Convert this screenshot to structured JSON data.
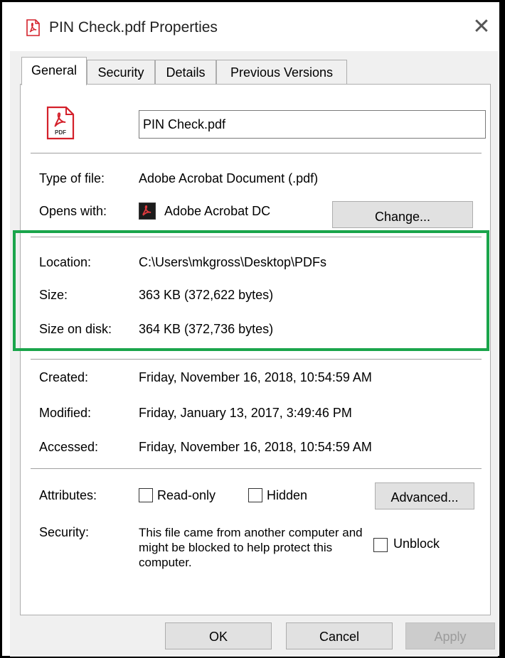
{
  "window": {
    "title": "PIN Check.pdf Properties",
    "close_icon": "close-icon"
  },
  "tabs": [
    {
      "label": "General",
      "active": true
    },
    {
      "label": "Security"
    },
    {
      "label": "Details"
    },
    {
      "label": "Previous Versions"
    }
  ],
  "general": {
    "file_icon": "pdf-file-icon",
    "file_icon_text": "PDF",
    "file_name": "PIN Check.pdf",
    "type_label": "Type of file:",
    "type_value": "Adobe Acrobat Document (.pdf)",
    "opens_label": "Opens with:",
    "opens_value": "Adobe Acrobat DC",
    "change_button": "Change...",
    "location_label": "Location:",
    "location_value": "C:\\Users\\mkgross\\Desktop\\PDFs",
    "size_label": "Size:",
    "size_value": "363 KB (372,622 bytes)",
    "size_on_disk_label": "Size on disk:",
    "size_on_disk_value": "364 KB (372,736 bytes)",
    "created_label": "Created:",
    "created_value": "Friday, November 16, 2018, 10:54:59 AM",
    "modified_label": "Modified:",
    "modified_value": "Friday, January 13, 2017, 3:49:46 PM",
    "accessed_label": "Accessed:",
    "accessed_value": "Friday, November 16, 2018, 10:54:59 AM",
    "attributes_label": "Attributes:",
    "readonly_label": "Read-only",
    "readonly_checked": false,
    "hidden_label": "Hidden",
    "hidden_checked": false,
    "advanced_button": "Advanced...",
    "security_label": "Security:",
    "security_text": "This file came from another computer and might be blocked to help protect this computer.",
    "unblock_label": "Unblock",
    "unblock_checked": false
  },
  "footer": {
    "ok_button": "OK",
    "cancel_button": "Cancel",
    "apply_button": "Apply",
    "apply_disabled": true
  },
  "colors": {
    "highlight": "#1aa54b",
    "pdf_red": "#d4202a",
    "window_bg": "#f0f0f0"
  }
}
